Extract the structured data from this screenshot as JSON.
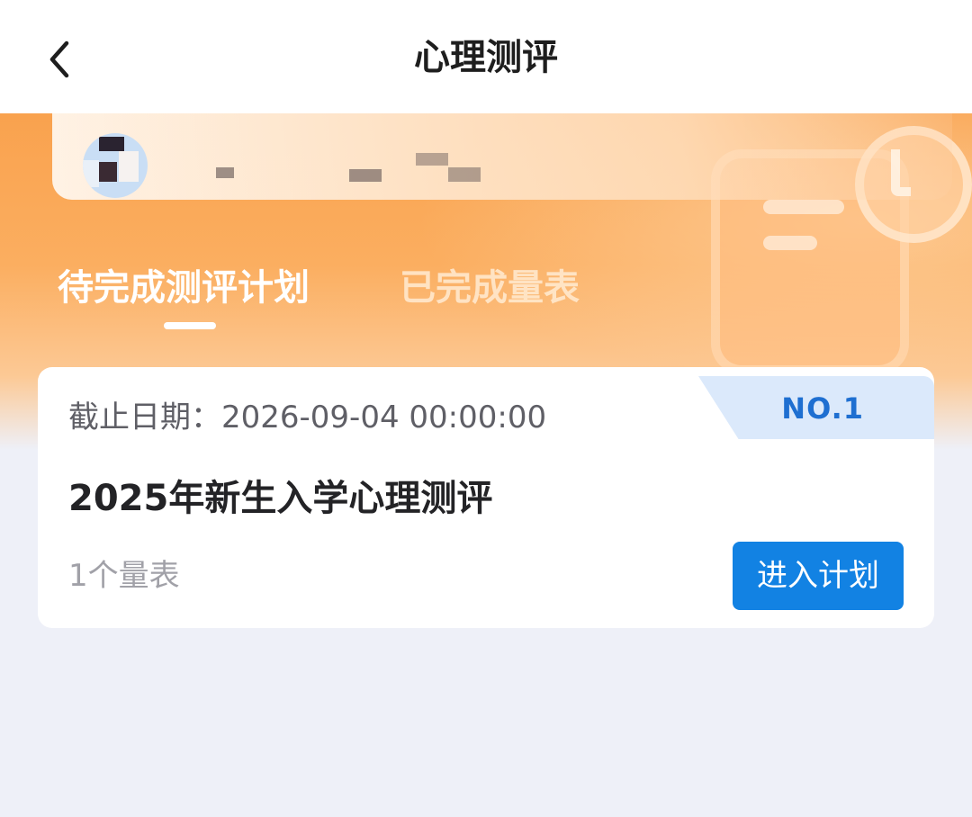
{
  "colors": {
    "accent_orange": "#f9a24e",
    "primary_blue": "#1282e3",
    "badge_bg": "#dbe9fb",
    "badge_text": "#1e6fd1",
    "page_bg": "#eef0f8"
  },
  "navbar": {
    "back_icon": "chevron-left-icon",
    "title": "心理测评"
  },
  "tabs": [
    {
      "label": "待完成测评计划",
      "active": true
    },
    {
      "label": "已完成量表",
      "active": false
    }
  ],
  "plan_card": {
    "rank": "NO.1",
    "deadline": "截止日期：2026-09-04 00:00:00",
    "title": "2025年新生入学心理测评",
    "scale_count": "1个量表",
    "enter_button": "进入计划"
  }
}
